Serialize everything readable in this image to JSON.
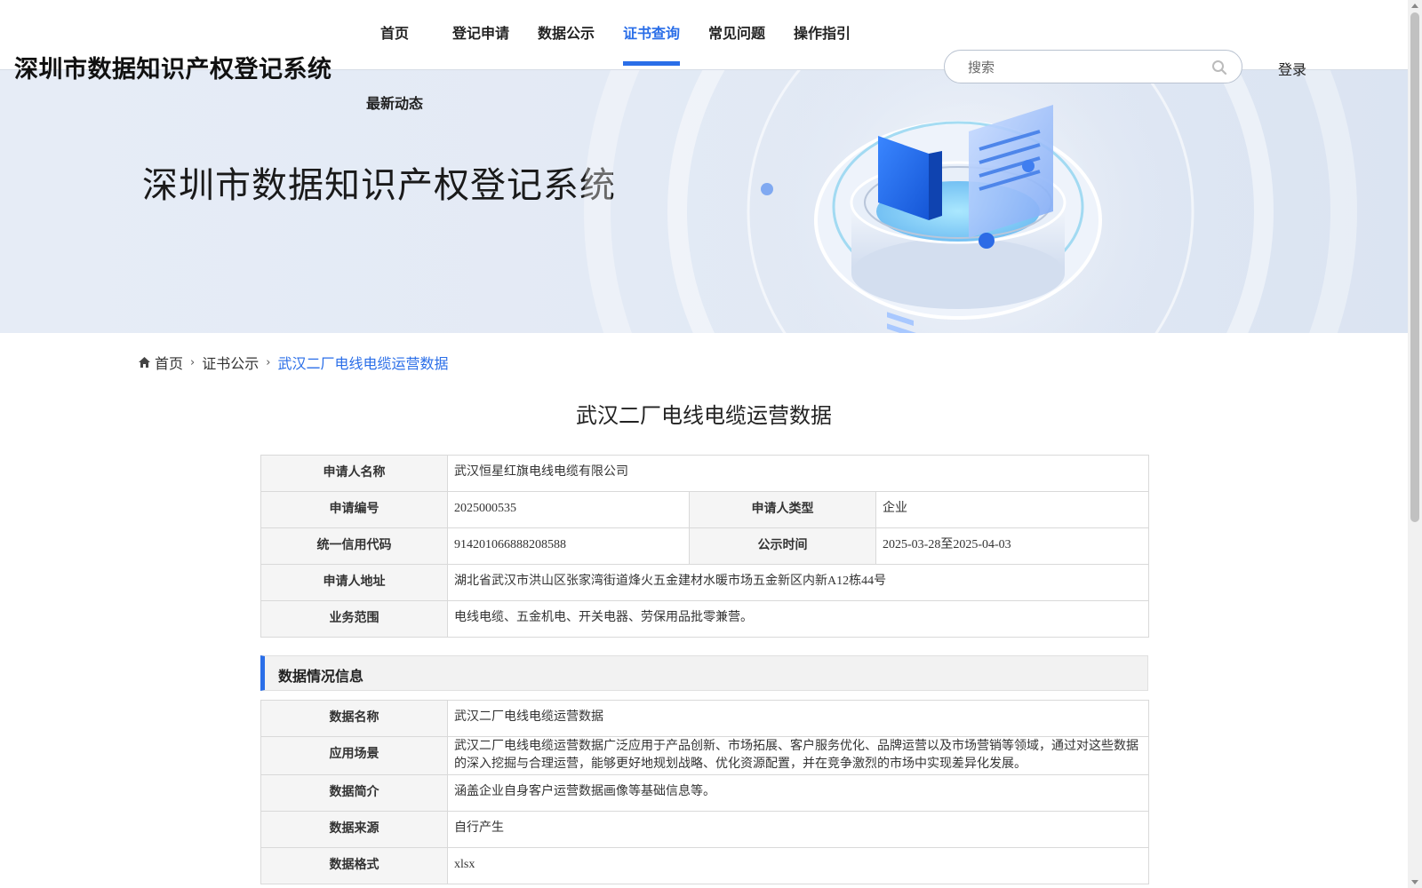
{
  "header": {
    "site_title": "深圳市数据知识产权登记系统",
    "nav": [
      {
        "label": "首页"
      },
      {
        "label": "登记申请"
      },
      {
        "label": "数据公示"
      },
      {
        "label": "证书查询",
        "active": true
      },
      {
        "label": "常见问题"
      },
      {
        "label": "操作指引"
      }
    ],
    "nav_second_row": "最新动态",
    "search_placeholder": "搜索",
    "login_label": "登录"
  },
  "banner": {
    "title": "深圳市数据知识产权登记系统"
  },
  "breadcrumb": {
    "home": "首页",
    "level2": "证书公示",
    "current": "武汉二厂电线电缆运营数据"
  },
  "page_title": "武汉二厂电线电缆运营数据",
  "applicant": {
    "name_label": "申请人名称",
    "name": "武汉恒星红旗电线电缆有限公司",
    "app_no_label": "申请编号",
    "app_no": "2025000535",
    "type_label": "申请人类型",
    "type": "企业",
    "credit_code_label": "统一信用代码",
    "credit_code": "914201066888208588",
    "publicity_label": "公示时间",
    "publicity": "2025-03-28至2025-04-03",
    "address_label": "申请人地址",
    "address": "湖北省武汉市洪山区张家湾街道烽火五金建材水暖市场五金新区内新A12栋44号",
    "scope_label": "业务范围",
    "scope": "电线电缆、五金机电、开关电器、劳保用品批零兼营。"
  },
  "data_section": {
    "title": "数据情况信息",
    "name_label": "数据名称",
    "name": "武汉二厂电线电缆运营数据",
    "scene_label": "应用场景",
    "scene": "武汉二厂电线电缆运营数据广泛应用于产品创新、市场拓展、客户服务优化、品牌运营以及市场营销等领域，通过对这些数据的深入挖掘与合理运营，能够更好地规划战略、优化资源配置，并在竞争激烈的市场中实现差异化发展。",
    "intro_label": "数据简介",
    "intro": "涵盖企业自身客户运营数据画像等基础信息等。",
    "source_label": "数据来源",
    "source": "自行产生",
    "format_label": "数据格式",
    "format": "xlsx"
  },
  "colors": {
    "accent": "#2a6ee8",
    "label_bg": "#f5f5f5",
    "border": "#d9d9d9"
  }
}
